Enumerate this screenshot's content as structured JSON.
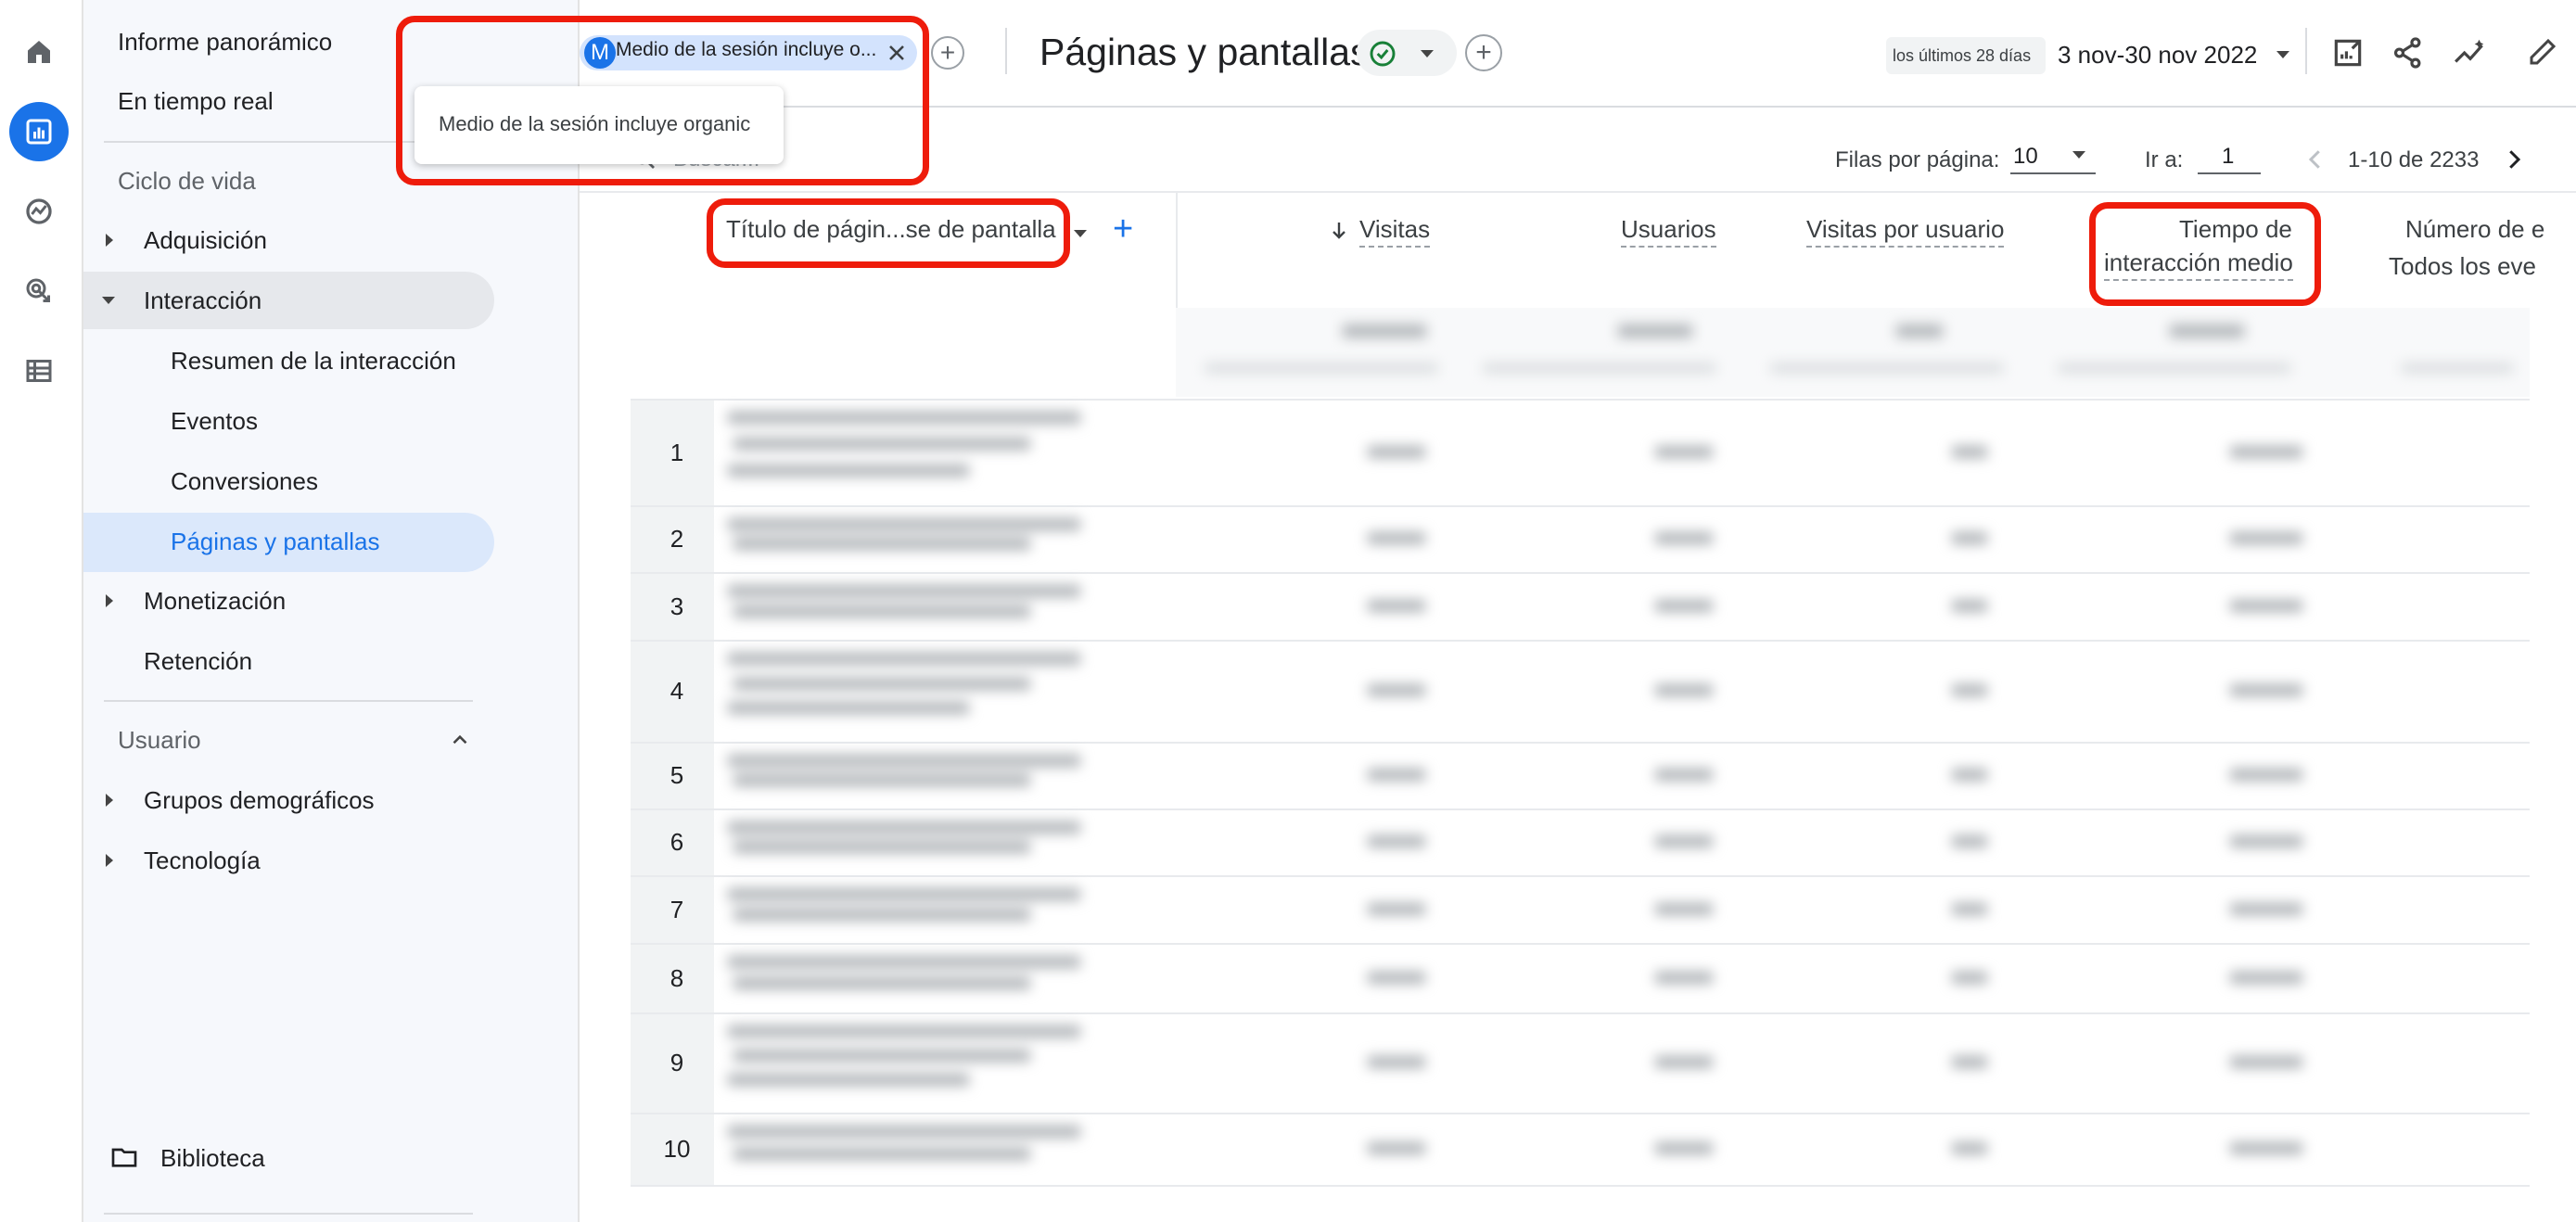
{
  "rail": {
    "icons": [
      "home-icon",
      "reports-icon",
      "explore-icon",
      "advertising-icon",
      "configure-icon"
    ]
  },
  "sidebar": {
    "top_items": [
      "Informe panorámico",
      "En tiempo real"
    ],
    "lifecycle_label": "Ciclo de vida",
    "adquisicion": "Adquisición",
    "interaccion": "Interacción",
    "interaccion_children": [
      "Resumen de la interacción",
      "Eventos",
      "Conversiones",
      "Páginas y pantallas"
    ],
    "monetizacion": "Monetización",
    "retencion": "Retención",
    "usuario_label": "Usuario",
    "grupos": "Grupos demográficos",
    "tecnologia": "Tecnología",
    "biblioteca": "Biblioteca"
  },
  "header": {
    "chip_avatar": "M",
    "chip_text": "Medio de la sesión incluye o...",
    "tooltip": "Medio de la sesión incluye organic",
    "title": "Páginas y pantallas",
    "date_caption": "los últimos 28 días",
    "date_range": "3 nov-30 nov 2022"
  },
  "toolbar": {
    "search_placeholder": "Buscar...",
    "rows_label": "Filas por página:",
    "rows_value": "10",
    "goto_label": "Ir a:",
    "goto_value": "1",
    "range": "1-10 de 2233"
  },
  "table": {
    "dimension": "Título de págin...se de pantalla",
    "columns": {
      "visitas": "Visitas",
      "usuarios": "Usuarios",
      "visitas_usuario": "Visitas por usuario",
      "tiempo_line1": "Tiempo de",
      "tiempo_line2": "interacción medio",
      "numero": "Número de e",
      "numero_sub": "Todos los eve"
    },
    "rows": [
      "1",
      "2",
      "3",
      "4",
      "5",
      "6",
      "7",
      "8",
      "9",
      "10"
    ]
  },
  "colors": {
    "accent": "#1a73e8",
    "highlight": "#ee1c0b",
    "chip": "#d3e3fd"
  }
}
